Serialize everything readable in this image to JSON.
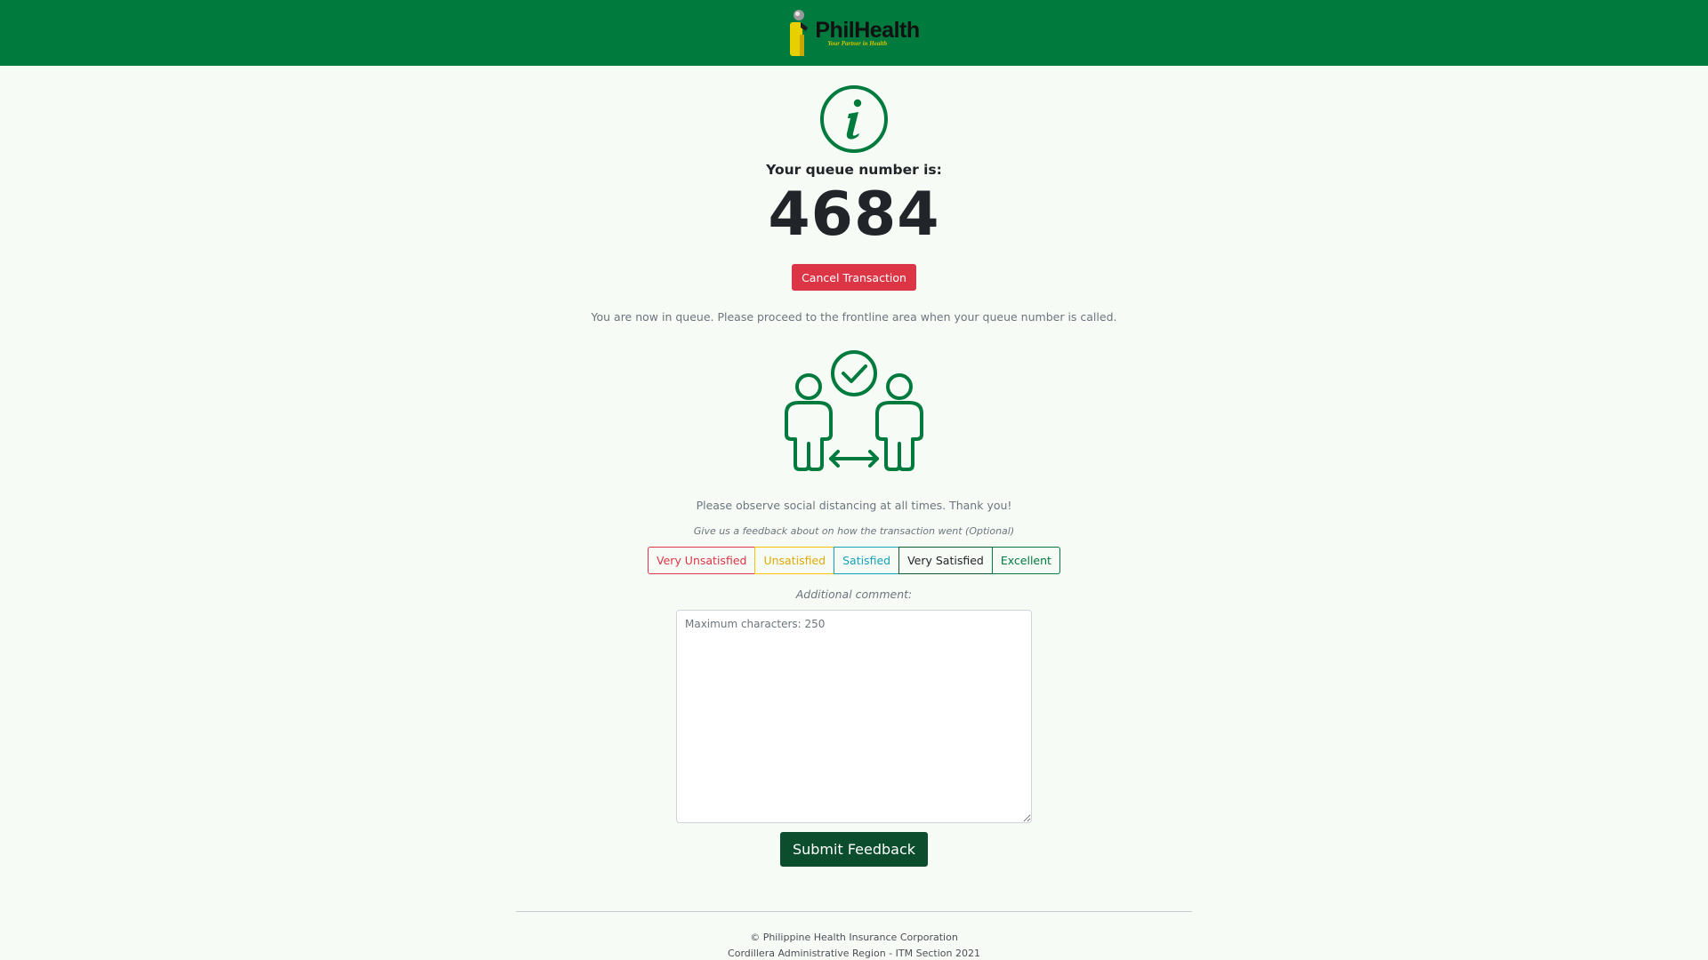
{
  "header": {
    "logo_name": "PhilHealth",
    "logo_tagline": "Your Partner in Health",
    "brand_color": "#007a3d"
  },
  "queue": {
    "label": "Your queue number is:",
    "number": "4684",
    "cancel_label": "Cancel Transaction",
    "message": "You are now in queue. Please proceed to the frontline area when your queue number is called."
  },
  "distancing": {
    "message": "Please observe social distancing at all times. Thank you!"
  },
  "feedback": {
    "prompt": "Give us a feedback about on how the transaction went (Optional)",
    "ratings": [
      {
        "label": "Very Unsatisfied",
        "color": "#dc3545"
      },
      {
        "label": "Unsatisfied",
        "color": "#ffc107"
      },
      {
        "label": "Satisfied",
        "color": "#17a2b8"
      },
      {
        "label": "Very Satisfied",
        "color": "#212529"
      },
      {
        "label": "Excellent",
        "color": "#007a3d"
      }
    ],
    "comment_label": "Additional comment:",
    "comment_placeholder": "Maximum characters: 250",
    "comment_value": "",
    "submit_label": "Submit Feedback"
  },
  "footer": {
    "line1": "© Philippine Health Insurance Corporation",
    "line2": "Cordillera Administrative Region - ITM Section 2021"
  },
  "icons": {
    "info": "info-circle-icon",
    "distancing": "social-distancing-icon"
  }
}
